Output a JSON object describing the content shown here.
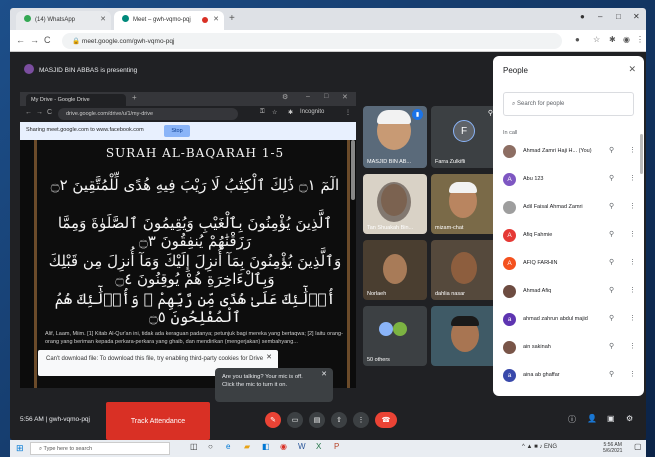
{
  "browser": {
    "tab1": {
      "title": "(14) WhatsApp"
    },
    "tab2": {
      "title": "Meet – gwh-vqmo-pqj"
    },
    "url": "meet.google.com/gwh-vqmo-pqj"
  },
  "meet": {
    "presenting_banner": "MASJID BIN ABBAS is presenting",
    "code": "gwh-vqmo-pqj",
    "time": "5:56 AM",
    "track_attendance_label": "Track Attendance",
    "tooltip": {
      "line1": "Are you talking? Your mic is off.",
      "line2": "Click the mic to turn it on."
    },
    "tiles": [
      {
        "name": "MASJID BIN AB..."
      },
      {
        "name": "Farra Zulkifli",
        "initial": "F"
      },
      {
        "name": "Tan Shuakah Bin..."
      },
      {
        "name": "mizam-chat"
      },
      {
        "name": "Norlaeh"
      },
      {
        "name": "dahlia nasar"
      },
      {
        "name": "50 others"
      },
      {
        "name": ""
      }
    ]
  },
  "shared_screen": {
    "tab_title": "My Drive - Google Drive",
    "url": "drive.google.com/drive/u/1/my-drive",
    "share_notice": "Sharing meet.google.com to www.facebook.com",
    "stop_label": "Stop",
    "profile_label": "Incognito",
    "surah_title": "SURAH AL-BAQARAH 1-5",
    "ayah1": "الٓمٓ ۝١ ذَٰلِكَ ٱلْكِتَٰبُ لَا رَيْبَ فِيهِ هُدًى لِّلْمُتَّقِينَ ۝٢",
    "ayah2": "ٱلَّذِينَ يُؤْمِنُونَ بِٱلْغَيْبِ وَيُقِيمُونَ ٱلصَّلَوٰةَ وَمِمَّا رَزَقْنَٰهُمْ يُنفِقُونَ ۝٣",
    "ayah3": "وَٱلَّذِينَ يُؤْمِنُونَ بِمَآ أُنزِلَ إِلَيْكَ وَمَآ أُنزِلَ مِن قَبْلِكَ وَبِٱلْءَاخِرَةِ هُمْ يُوقِنُونَ ۝٤",
    "ayah4": "أُو۟لَٰٓئِكَ عَلَىٰ هُدًى مِّن رَّبِّهِمْ ۖ وَأُو۟لَٰٓئِكَ هُمُ ٱلْمُفْلِحُونَ ۝٥",
    "translation": "Alif, Laam, Miim. [1] Kitab Al-Qur'an ini, tidak ada keraguan padanya; petunjuk bagi mereka yang bertaqwa; [2] Iaitu orang-orang yang beriman kepada perkara-perkara yang ghaib, dan mendirikan (mengerjakan) sembahyang...",
    "download_notice": "Can't download file: To download this file, try enabling third-party cookies for Drive"
  },
  "people_panel": {
    "title": "People",
    "search_placeholder": "Search for people",
    "section": "In call",
    "participants": [
      {
        "name": "Ahmad Zamri Haji H... (You)",
        "initial": "",
        "color": "#8d6e63"
      },
      {
        "name": "Abu 123",
        "initial": "A",
        "color": "#7e57c2"
      },
      {
        "name": "Adil Faisal Ahmad Zamri",
        "initial": "",
        "color": "#9e9e9e"
      },
      {
        "name": "Afiq Fahmie",
        "initial": "A",
        "color": "#e53935"
      },
      {
        "name": "AFIQ FARHIN",
        "initial": "A",
        "color": "#f4511e"
      },
      {
        "name": "Ahmad Afiq",
        "initial": "",
        "color": "#6d4c41"
      },
      {
        "name": "ahmad zahrun abdul majid",
        "initial": "a",
        "color": "#5e35b1"
      },
      {
        "name": "ain sakinah",
        "initial": "",
        "color": "#795548"
      },
      {
        "name": "aina ab ghaffar",
        "initial": "a",
        "color": "#3949ab"
      }
    ]
  },
  "taskbar": {
    "search_placeholder": "Type here to search",
    "time": "5:56 AM",
    "date": "5/6/2021"
  },
  "colors": {
    "accent_red": "#d93025",
    "meet_bg": "#202124",
    "link_blue": "#8ab4f8"
  }
}
